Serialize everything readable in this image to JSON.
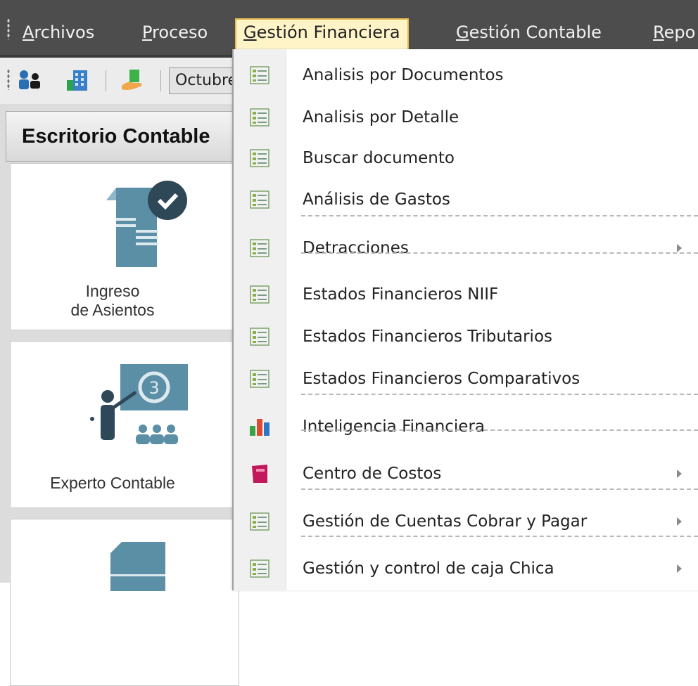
{
  "menubar": {
    "items": [
      {
        "label": "Archivos",
        "mnemonic": "A",
        "rest": "rchivos"
      },
      {
        "label": "Proceso",
        "mnemonic": "P",
        "rest": "roceso"
      },
      {
        "label": "Gestión Financiera",
        "mnemonic": "G",
        "rest": "estión Financiera"
      },
      {
        "label": "Gestión Contable",
        "mnemonic": "G",
        "rest": "estión Contable"
      },
      {
        "label": "Repo",
        "mnemonic": "R",
        "rest": "epo"
      }
    ]
  },
  "toolbar": {
    "month_value": "Octubre"
  },
  "panel": {
    "title": "Escritorio Contable",
    "tiles": [
      {
        "line1": "Ingreso",
        "line2": "de Asientos"
      },
      {
        "line1": "Experto Contable"
      }
    ]
  },
  "dropdown": {
    "items": [
      {
        "label": "Analisis por Documentos",
        "icon": "list-icon",
        "submenu": false
      },
      {
        "label": "Analisis por Detalle",
        "icon": "list-icon",
        "submenu": false
      },
      {
        "label": "Buscar documento",
        "icon": "list-icon",
        "submenu": false
      },
      {
        "label": "Análisis de Gastos",
        "icon": "list-icon",
        "submenu": false
      },
      {
        "label": "Detracciones",
        "icon": "list-icon",
        "submenu": true
      },
      {
        "label": "Estados Financieros NIIF",
        "icon": "list-icon",
        "submenu": false
      },
      {
        "label": "Estados Financieros Tributarios",
        "icon": "list-icon",
        "submenu": false
      },
      {
        "label": "Estados Financieros Comparativos",
        "icon": "list-icon",
        "submenu": false
      },
      {
        "label": "Inteligencia Financiera",
        "icon": "bar-chart-icon",
        "submenu": false
      },
      {
        "label": "Centro de Costos",
        "icon": "pink-book-icon",
        "submenu": true
      },
      {
        "label": "Gestión de Cuentas Cobrar y Pagar",
        "icon": "list-icon",
        "submenu": true
      },
      {
        "label": "Gestión y control de caja Chica",
        "icon": "list-icon",
        "submenu": true
      }
    ]
  },
  "colors": {
    "menubar": "#4d4d4d",
    "active_menu": "#fff4c7",
    "active_border": "#e6b94e",
    "tile_icon": "#5b8fa6"
  }
}
